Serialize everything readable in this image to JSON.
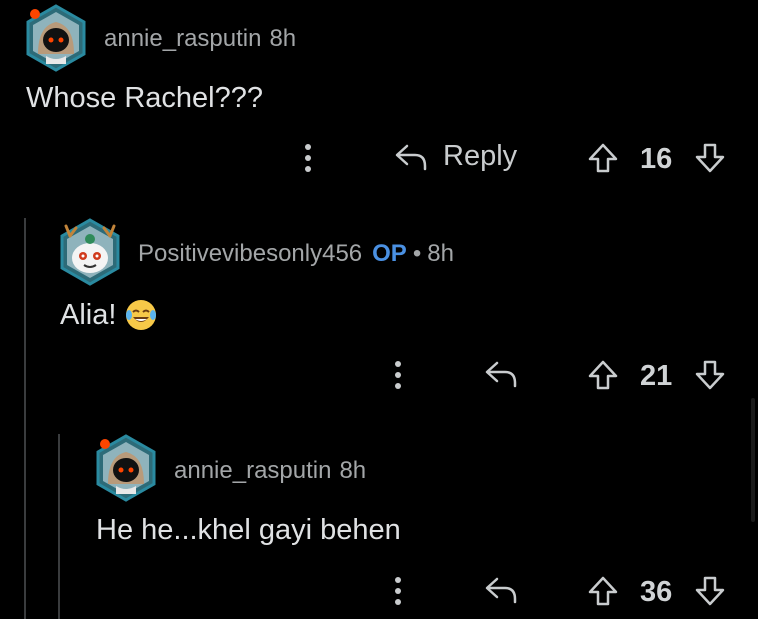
{
  "comments": [
    {
      "username": "annie_rasputin",
      "time": "8h",
      "body": "Whose Rachel???",
      "reply_label": "Reply",
      "votes": "16"
    },
    {
      "username": "Positivevibesonly456",
      "op_badge": "OP",
      "separator": "•",
      "time": "8h",
      "body": "Alia!",
      "votes": "21"
    },
    {
      "username": "annie_rasputin",
      "time": "8h",
      "body": "He he...khel gayi behen",
      "votes": "36"
    }
  ],
  "icons": {
    "more": "more-vertical-icon",
    "reply": "reply-arrow-icon",
    "upvote": "upvote-arrow-icon",
    "downvote": "downvote-arrow-icon",
    "emoji": "tears-of-joy-emoji"
  },
  "colors": {
    "background": "#000000",
    "op_badge": "#4a90e2",
    "thread_line": "#3a3c3e",
    "text": "#e0e2e4",
    "meta": "#a3a6a8"
  }
}
